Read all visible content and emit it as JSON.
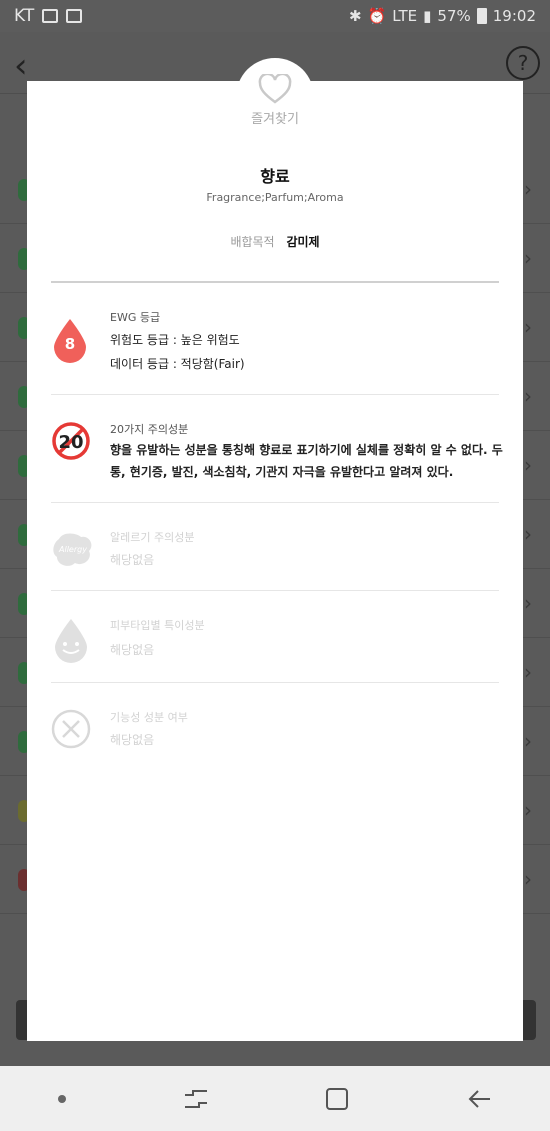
{
  "status_bar": {
    "carrier": "KT",
    "network": "LTE",
    "battery": "57%",
    "time": "19:02"
  },
  "modal": {
    "favorite_label": "즐겨찾기",
    "ingredient_name": "향료",
    "ingredient_aliases": "Fragrance;Parfum;Aroma",
    "purpose_label": "배합목적",
    "purpose_value": "감미제",
    "sections": {
      "ewg": {
        "title": "EWG 등급",
        "grade": "8",
        "risk_line": "위험도 등급 : 높은 위험도",
        "data_line": "데이터 등급 : 적당함(Fair)",
        "accent_color": "#f0605a"
      },
      "caution20": {
        "title": "20가지 주의성분",
        "badge": "20",
        "body": "향을 유발하는 성분을 통칭해 향료로 표기하기에 실체를 정확히 알 수 없다. 두통, 현기증, 발진, 색소침착, 기관지 자극을 유발한다고 알려져 있다.",
        "accent_color": "#e53935"
      },
      "allergy": {
        "title": "알레르기 주의성분",
        "value": "해당없음",
        "badge": "Allergy"
      },
      "skin_type": {
        "title": "피부타입별 특이성분",
        "value": "해당없음"
      },
      "functional": {
        "title": "기능성 성분 여부",
        "value": "해당없음"
      }
    }
  }
}
